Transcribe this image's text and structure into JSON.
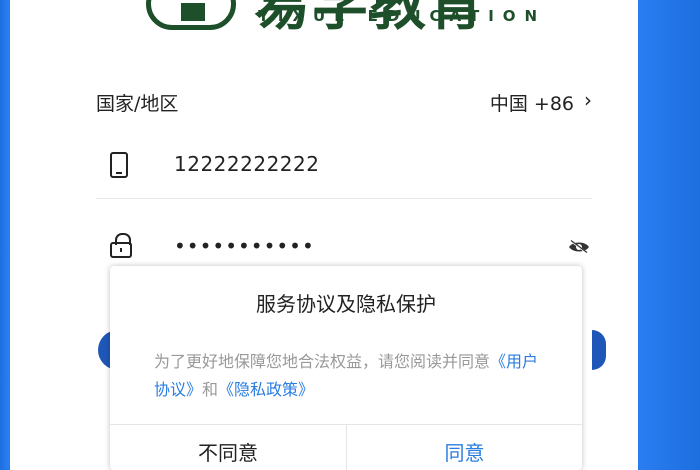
{
  "brand": {
    "name": "易学教育",
    "tagline": "YIXUE EDUCATION",
    "seal_text": "YIXUE EDUCATION"
  },
  "form": {
    "region": {
      "label": "国家/地区",
      "value": "中国 +86",
      "chevron": "›"
    },
    "phone": {
      "value": "12222222222"
    },
    "password": {
      "value": "•••••••••••"
    }
  },
  "dialog": {
    "title": "服务协议及隐私保护",
    "body_prefix": "为了更好地保障您地合法权益，请您阅读并同意",
    "link_terms": "《用户协议》",
    "body_and": "和",
    "link_privacy": "《隐私政策》",
    "disagree": "不同意",
    "agree": "同意"
  },
  "colors": {
    "accent": "#2a7de1",
    "brand_green": "#1d4f2a",
    "background_blue": "#2f7be6",
    "button_blue": "#1f57b8"
  }
}
